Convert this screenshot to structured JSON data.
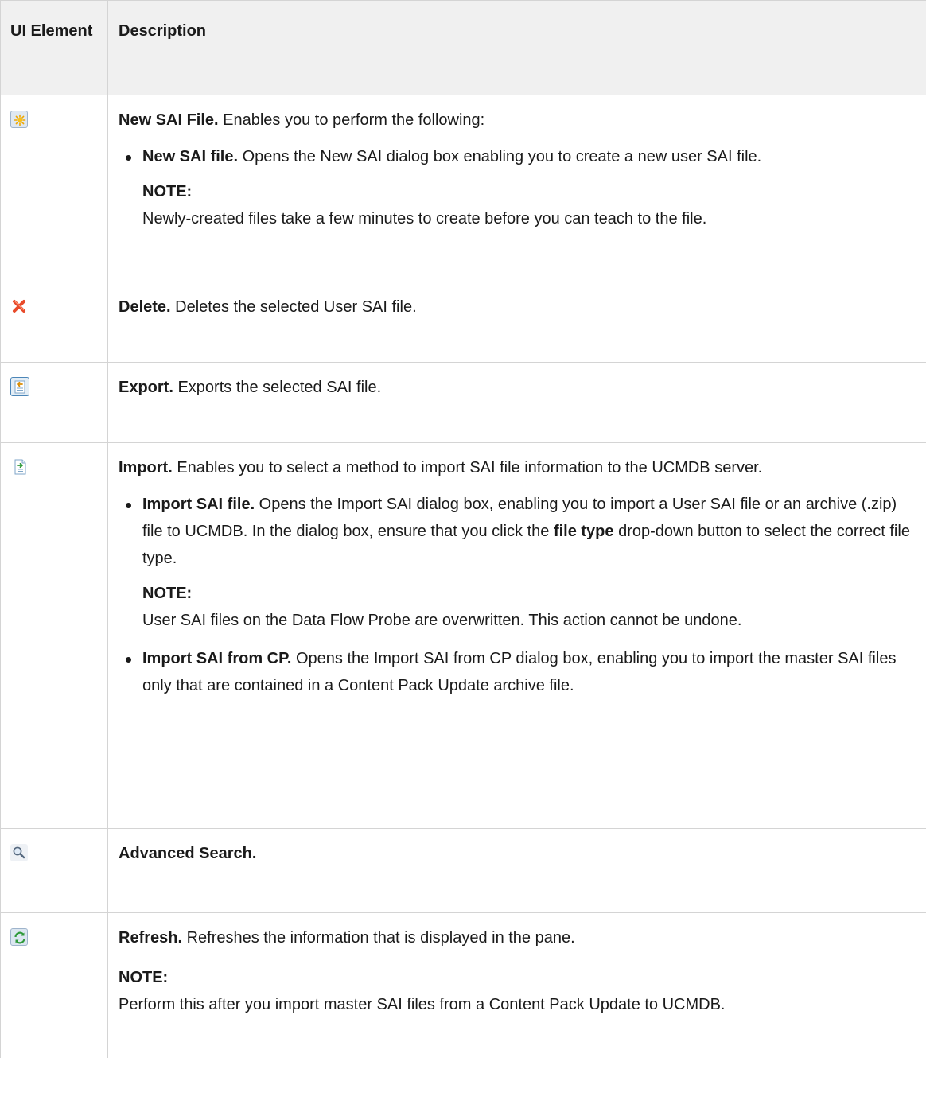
{
  "header": {
    "col1": "UI Element",
    "col2": "Description"
  },
  "rows": [
    {
      "icon": "new-file-icon",
      "title": "New SAI File.",
      "text": " Enables you to perform the following:",
      "bullets": [
        {
          "title": "New SAI file.",
          "text": " Opens the New SAI dialog box enabling you to create a new user SAI file.",
          "note_label": "NOTE:",
          "note_text": "Newly-created files take a few minutes to create before you can teach to the file."
        }
      ]
    },
    {
      "icon": "delete-icon",
      "title": "Delete.",
      "text": " Deletes the selected User SAI file."
    },
    {
      "icon": "export-icon",
      "title": "Export.",
      "text": " Exports the selected SAI file."
    },
    {
      "icon": "import-icon",
      "title": "Import.",
      "text": " Enables you to select a method to import SAI file information to the UCMDB server.",
      "bullets": [
        {
          "title": "Import SAI file.",
          "text_a": " Opens the Import SAI dialog box, enabling you to import a User SAI file or an archive (.zip) file to UCMDB. In the dialog box, ensure that you click the ",
          "text_bold": "file type",
          "text_b": " drop-down button to select the correct file type.",
          "note_label": "NOTE:",
          "note_text": "User SAI files on the Data Flow Probe are overwritten. This action cannot be undone."
        },
        {
          "title": "Import SAI from CP.",
          "text": " Opens the Import SAI from CP dialog box, enabling you to import the master SAI files only that are contained in a Content Pack Update archive file."
        }
      ]
    },
    {
      "icon": "search-icon",
      "title": "Advanced Search."
    },
    {
      "icon": "refresh-icon",
      "title": "Refresh.",
      "text": " Refreshes the information that is displayed in the pane.",
      "note_label": "NOTE:",
      "note_text": "Perform this after you import master SAI files from a Content Pack Update to UCMDB."
    }
  ]
}
